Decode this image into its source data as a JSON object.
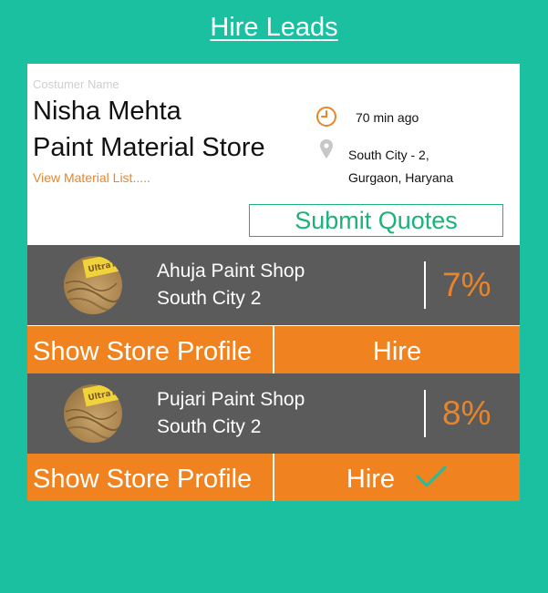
{
  "header": {
    "title": "Hire Leads"
  },
  "lead": {
    "customer_label": "Costumer Name",
    "customer_name": "Nisha Mehta",
    "store_name": "Paint Material Store",
    "material_link": "View Material List.....",
    "time_ago": "70 min ago",
    "address_line1": "South City - 2,",
    "address_line2": "Gurgaon, Haryana",
    "submit_label": "Submit Quotes",
    "icons": {
      "clock": "clock-icon",
      "pin": "location-pin-icon"
    }
  },
  "shops": [
    {
      "name": "Ahuja Paint Shop",
      "location": "South City 2",
      "percent": "7%",
      "profile_label": "Show Store Profile",
      "hire_label": "Hire"
    },
    {
      "name": "Pujari Paint Shop",
      "location": "South City 2",
      "percent": "8%",
      "profile_label": "Show Store Profile",
      "hire_label": "Hire",
      "hired": true
    }
  ],
  "colors": {
    "background": "#1bc0a0",
    "accent_orange": "#f0831f",
    "submit_green": "#1ab37a",
    "row_gray": "#5b5b5b",
    "check_teal": "#1bc0a0"
  }
}
